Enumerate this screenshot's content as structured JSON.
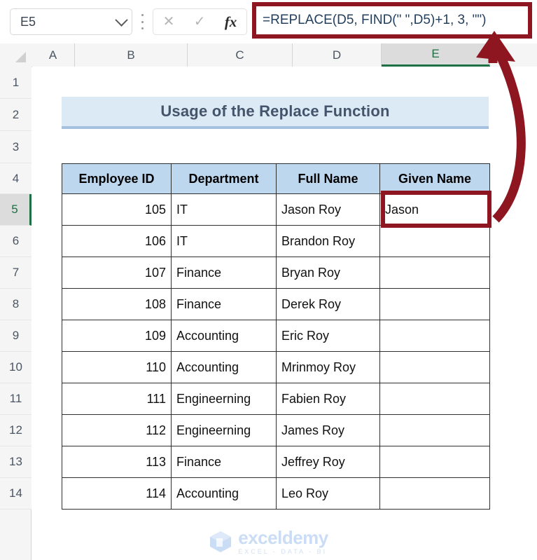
{
  "formula_bar": {
    "name_box_value": "E5",
    "name_box_chevron_icon": "chevron-down-icon",
    "drag_handle_icon": "vertical-dots-icon",
    "cancel_icon": "✕",
    "enter_icon": "✓",
    "insert_function_icon": "fx",
    "formula": "=REPLACE(D5, FIND(\" \",D5)+1, 3, \"\")",
    "highlight_color": "#8e1620"
  },
  "grid": {
    "columns": [
      "A",
      "B",
      "C",
      "D",
      "E"
    ],
    "selected_column": "E",
    "rows": [
      "1",
      "2",
      "3",
      "4",
      "5",
      "6",
      "7",
      "8",
      "9",
      "10",
      "11",
      "12",
      "13",
      "14"
    ],
    "selected_row": "5",
    "selection_accent": "#1d7044",
    "select_all_icon": "select-all-triangle-icon"
  },
  "title": {
    "text": "Usage of the Replace Function",
    "fill": "#dceaf6",
    "underline": "#a6c0e0",
    "text_color": "#44546a"
  },
  "table": {
    "header_fill": "#bdd7ee",
    "headers": [
      "Employee ID",
      "Department",
      "Full Name",
      "Given Name"
    ],
    "rows": [
      {
        "employee_id": "105",
        "department": "IT",
        "full_name": "Jason Roy",
        "given_name": "Jason"
      },
      {
        "employee_id": "106",
        "department": "IT",
        "full_name": "Brandon Roy",
        "given_name": ""
      },
      {
        "employee_id": "107",
        "department": "Finance",
        "full_name": "Bryan Roy",
        "given_name": ""
      },
      {
        "employee_id": "108",
        "department": "Finance",
        "full_name": "Derek Roy",
        "given_name": ""
      },
      {
        "employee_id": "109",
        "department": "Accounting",
        "full_name": "Eric Roy",
        "given_name": ""
      },
      {
        "employee_id": "110",
        "department": "Accounting",
        "full_name": "Mrinmoy Roy",
        "given_name": ""
      },
      {
        "employee_id": "111",
        "department": "Engineerning",
        "full_name": "Fabien Roy",
        "given_name": ""
      },
      {
        "employee_id": "112",
        "department": "Engineerning",
        "full_name": "James Roy",
        "given_name": ""
      },
      {
        "employee_id": "113",
        "department": "Finance",
        "full_name": "Jeffrey Roy",
        "given_name": ""
      },
      {
        "employee_id": "114",
        "department": "Accounting",
        "full_name": "Leo Roy",
        "given_name": ""
      }
    ]
  },
  "annotation": {
    "arrow_color": "#8e1620",
    "arrow_name": "curved-arrow-to-formula-bar"
  },
  "watermark": {
    "name": "exceldemy",
    "tagline": "EXCEL - DATA - BI",
    "color": "#cbdcf5"
  }
}
